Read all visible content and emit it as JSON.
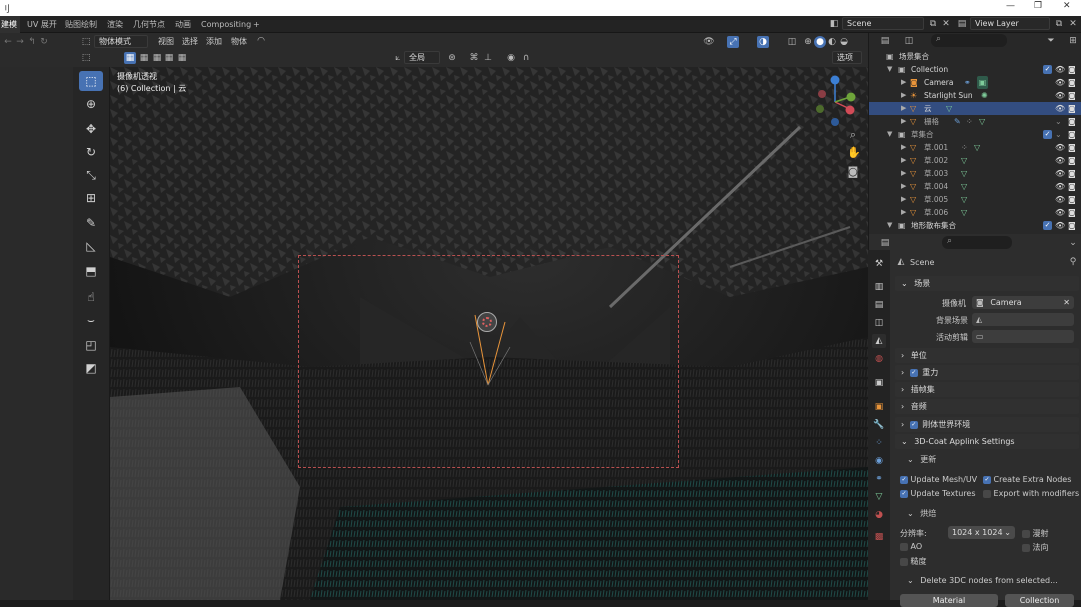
{
  "titlebar": {
    "icon": "刂",
    "min": "—",
    "max": "❐",
    "close": "✕"
  },
  "workspace_tabs": [
    "建模",
    "UV 展开",
    "贴图绘制",
    "渲染",
    "几何节点",
    "动画",
    "Compositing",
    "+"
  ],
  "scene_selector": {
    "value": "Scene"
  },
  "view_layer": {
    "value": "View Layer"
  },
  "viewport_header": {
    "mode": "物体模式",
    "menus": [
      "视图",
      "选择",
      "添加",
      "物体"
    ],
    "transform_orientation": "全局",
    "options": "选项"
  },
  "viewport": {
    "info_line1": "摄像机透视",
    "info_line2": "(6) Collection | 云"
  },
  "outliner": {
    "search_placeholder": "",
    "rows": [
      {
        "name": "场景集合"
      },
      {
        "name": "Collection"
      },
      {
        "name": "Camera"
      },
      {
        "name": "Starlight Sun"
      },
      {
        "name": "云"
      },
      {
        "name": "栅格"
      },
      {
        "name": "草集合"
      },
      {
        "name": "草.001"
      },
      {
        "name": "草.002"
      },
      {
        "name": "草.003"
      },
      {
        "name": "草.004"
      },
      {
        "name": "草.005"
      },
      {
        "name": "草.006"
      },
      {
        "name": "地形散布集合"
      }
    ]
  },
  "properties": {
    "context": "Scene",
    "scene_panel": {
      "title": "场景",
      "camera_label": "摄像机",
      "camera_value": "Camera",
      "background_label": "背景场景",
      "clip_label": "活动剪辑"
    },
    "panels": [
      "单位",
      "重力",
      "插帧集",
      "音频",
      "刚体世界环境",
      "3D-Coat Applink Settings"
    ],
    "update_section": "更新",
    "update_mesh_uv": "Update Mesh/UV",
    "create_extra_nodes": "Create Extra Nodes",
    "update_textures": "Update Textures",
    "export_with_modifiers": "Export with modifiers",
    "bake_section": "烘焙",
    "resolution_label": "分辨率:",
    "resolution_value": "1024 x 1024",
    "diffuse_label": "漫射",
    "ao_label": "AO",
    "normal_label": "法向",
    "roughness_label": "糙度",
    "delete_label": "Delete 3DC nodes from selected...",
    "material_btn": "Material",
    "collection_btn": "Collection"
  },
  "colors": {
    "accent": "#4772b3",
    "selected_row": "#334d80",
    "camera_frame": "#b95050",
    "object_orange": "#e8943a"
  }
}
